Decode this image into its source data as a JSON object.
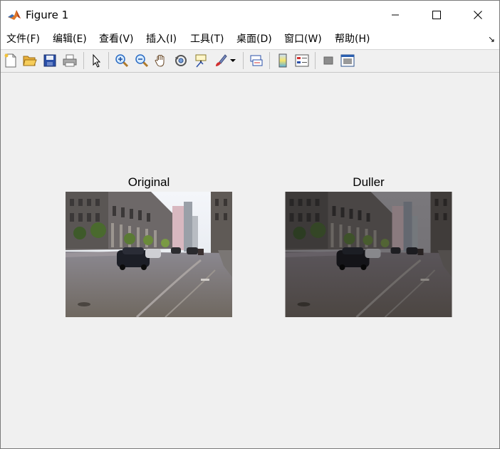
{
  "window": {
    "title": "Figure 1",
    "icon": "matlab-logo-icon",
    "buttons": [
      "minimize-icon",
      "maximize-icon",
      "close-icon"
    ]
  },
  "menu": {
    "items": [
      "文件(F)",
      "编辑(E)",
      "查看(V)",
      "插入(I)",
      "工具(T)",
      "桌面(D)",
      "窗口(W)",
      "帮助(H)"
    ],
    "overflow_icon": "dock-arrow-icon"
  },
  "toolbar": {
    "icons": [
      "new-figure-icon",
      "open-file-icon",
      "save-icon",
      "print-icon",
      "select-pointer-icon",
      "zoom-in-icon",
      "zoom-out-icon",
      "pan-hand-icon",
      "rotate-3d-icon",
      "data-cursor-icon",
      "brush-icon",
      "link-plot-icon",
      "colorbar-icon",
      "legend-icon",
      "hide-plot-tools-icon",
      "show-plot-tools-icon"
    ]
  },
  "axes": [
    {
      "title": "Original",
      "image": "street-scene-original"
    },
    {
      "title": "Duller",
      "image": "street-scene-duller"
    }
  ],
  "colors": {
    "window_bg": "#f0f0f0",
    "titlebar_bg": "#ffffff"
  }
}
